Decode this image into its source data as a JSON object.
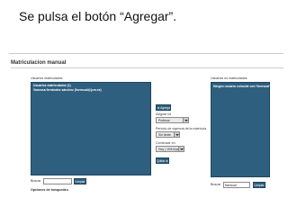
{
  "slide": {
    "title": "Se pulsa el botón “Agregar”."
  },
  "panel": {
    "title": "Matriculacion manual",
    "left": {
      "label": "Usuarios matriculados",
      "list_lines": [
        "Usuarios matriculados (1)",
        "Vanessa fernández sánchez (fsensual@jcm.es)"
      ],
      "search_label": "Buscar",
      "search_value": "",
      "clear_label": "Limpiar",
      "options_link": "Opciones de búsqueda"
    },
    "middle": {
      "add_label": "◄ Agregar",
      "assign_label": "Asignar rol",
      "role_value": "Profesor",
      "period_label": "Periodo de vigencia de la matrícula",
      "period_value": "Sin límite",
      "start_label": "Comenzar en",
      "start_value": "Hoy ( 15/10/(sel)",
      "remove_label": "Quitar ►"
    },
    "right": {
      "label": "Usuarios no matriculados",
      "list_lines": [
        "Ningún usuario coincide con 'fsensual'"
      ],
      "search_label": "Buscar",
      "search_value": "fsensual",
      "clear_label": "Limpiar"
    }
  }
}
